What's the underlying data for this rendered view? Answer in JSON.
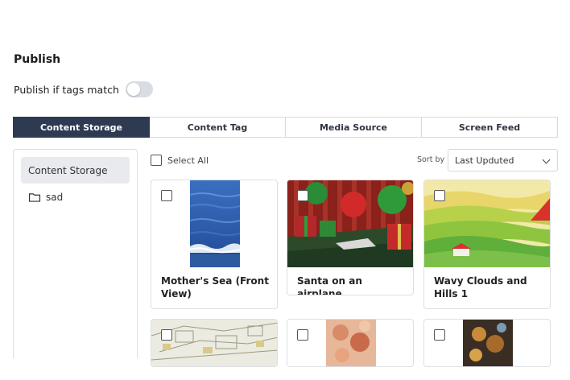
{
  "publish": {
    "title": "Publish",
    "toggle_label": "Publish if tags match"
  },
  "tabs": [
    {
      "label": "Content Storage",
      "active": true
    },
    {
      "label": "Content Tag"
    },
    {
      "label": "Media Source"
    },
    {
      "label": "Screen Feed"
    }
  ],
  "sidebar": {
    "items": [
      {
        "label": "Content Storage"
      },
      {
        "label": "sad",
        "icon": "folder-icon"
      }
    ]
  },
  "toolbar": {
    "select_all_label": "Select All",
    "sort_label": "Sort by",
    "sort_value": "Last Upduted"
  },
  "cards": [
    {
      "title": "Mother's Sea (Front View)"
    },
    {
      "title": "Santa on an airplane"
    },
    {
      "title": "Wavy Clouds and Hills 1"
    }
  ],
  "colors": {
    "accent": "#2e3a52",
    "toggle_off": "#d9dce3"
  }
}
